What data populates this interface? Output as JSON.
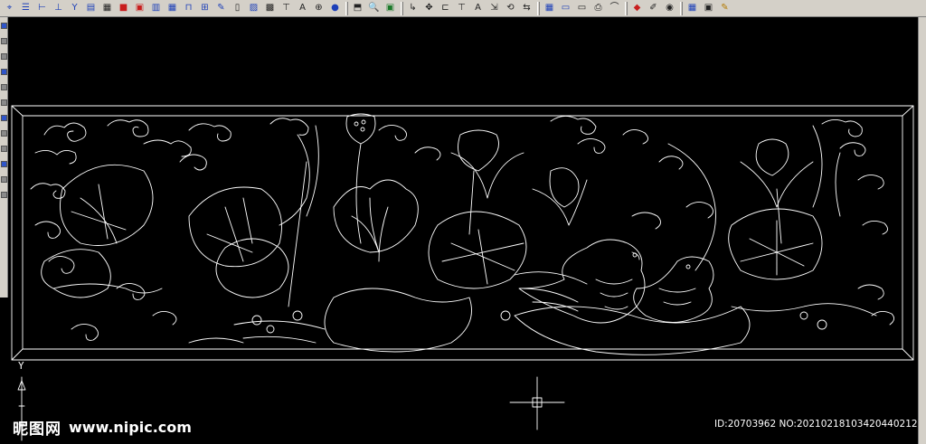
{
  "app": {
    "ucs_axis_label": "Y"
  },
  "toolbar": {
    "groups": [
      [
        {
          "icon": "snap-icon",
          "glyph": "⌖",
          "color": "c-blue"
        },
        {
          "icon": "grid-icon",
          "glyph": "☰",
          "color": "c-blue"
        },
        {
          "icon": "ortho-icon",
          "glyph": "⊢",
          "color": "c-blue"
        },
        {
          "icon": "polar-icon",
          "glyph": "⊥",
          "color": "c-blue"
        },
        {
          "icon": "branch-icon",
          "glyph": "Y",
          "color": "c-blue"
        },
        {
          "icon": "table-icon",
          "glyph": "▤",
          "color": "c-blue"
        },
        {
          "icon": "layers-icon",
          "glyph": "▦",
          "color": "c-dark"
        },
        {
          "icon": "color-icon",
          "glyph": "■",
          "color": "c-red"
        },
        {
          "icon": "properties-icon",
          "glyph": "▣",
          "color": "c-red"
        },
        {
          "icon": "block-icon",
          "glyph": "▥",
          "color": "c-blue"
        },
        {
          "icon": "column-icon",
          "glyph": "▦",
          "color": "c-blue"
        },
        {
          "icon": "door-icon",
          "glyph": "⊓",
          "color": "c-blue"
        },
        {
          "icon": "stair-icon",
          "glyph": "⊞",
          "color": "c-blue"
        },
        {
          "icon": "pen-icon",
          "glyph": "✎",
          "color": "c-blue"
        },
        {
          "icon": "document-icon",
          "glyph": "▯",
          "color": "c-dark"
        },
        {
          "icon": "image-icon",
          "glyph": "▨",
          "color": "c-blue"
        },
        {
          "icon": "hatch-icon",
          "glyph": "▩",
          "color": "c-dark"
        },
        {
          "icon": "text-align-icon",
          "glyph": "⊤",
          "color": "c-dark"
        },
        {
          "icon": "text-icon",
          "glyph": "A",
          "color": "c-dark"
        },
        {
          "icon": "globe-icon",
          "glyph": "⊕",
          "color": "c-dark"
        },
        {
          "icon": "help-icon",
          "glyph": "●",
          "color": "c-blue"
        }
      ],
      [
        {
          "icon": "zoom-window-icon",
          "glyph": "⬒",
          "color": "c-dark"
        },
        {
          "icon": "zoom-icon",
          "glyph": "🔍",
          "color": "c-dark"
        },
        {
          "icon": "regen-icon",
          "glyph": "▣",
          "color": "c-green"
        }
      ],
      [
        {
          "icon": "dimension-icon",
          "glyph": "↳",
          "color": "c-dark"
        },
        {
          "icon": "move-icon",
          "glyph": "✥",
          "color": "c-dark"
        },
        {
          "icon": "align-icon",
          "glyph": "⊏",
          "color": "c-dark"
        },
        {
          "icon": "text-align-2-icon",
          "glyph": "⊤",
          "color": "c-dark"
        },
        {
          "icon": "text-style-icon",
          "glyph": "A",
          "color": "c-dark"
        },
        {
          "icon": "scale-icon",
          "glyph": "⇲",
          "color": "c-dark"
        },
        {
          "icon": "rotate-icon",
          "glyph": "⟲",
          "color": "c-dark"
        },
        {
          "icon": "mirror-icon",
          "glyph": "⇆",
          "color": "c-dark"
        }
      ],
      [
        {
          "icon": "grid-view-icon",
          "glyph": "▦",
          "color": "c-blue"
        },
        {
          "icon": "ruler-icon",
          "glyph": "▭",
          "color": "c-blue"
        },
        {
          "icon": "monitor-icon",
          "glyph": "▭",
          "color": "c-dark"
        },
        {
          "icon": "print-icon",
          "glyph": "⎙",
          "color": "c-dark"
        },
        {
          "icon": "bridge-icon",
          "glyph": "⌒",
          "color": "c-dark"
        }
      ],
      [
        {
          "icon": "render-icon",
          "glyph": "◆",
          "color": "c-red"
        },
        {
          "icon": "brush-icon",
          "glyph": "✐",
          "color": "c-dark"
        },
        {
          "icon": "view-icon",
          "glyph": "◉",
          "color": "c-dark"
        }
      ],
      [
        {
          "icon": "frame-icon",
          "glyph": "▦",
          "color": "c-blue"
        },
        {
          "icon": "window-icon",
          "glyph": "▣",
          "color": "c-dark"
        },
        {
          "icon": "paint-icon",
          "glyph": "✎",
          "color": "c-gold"
        }
      ]
    ]
  },
  "watermark": {
    "cn": "昵图网",
    "url": "www.nipic.com"
  },
  "image_id": "ID:20703962 NO:20210218103420440212",
  "colors": {
    "canvas_bg": "#000000",
    "line": "#ffffff",
    "toolbar_bg": "#d4d0c8"
  }
}
